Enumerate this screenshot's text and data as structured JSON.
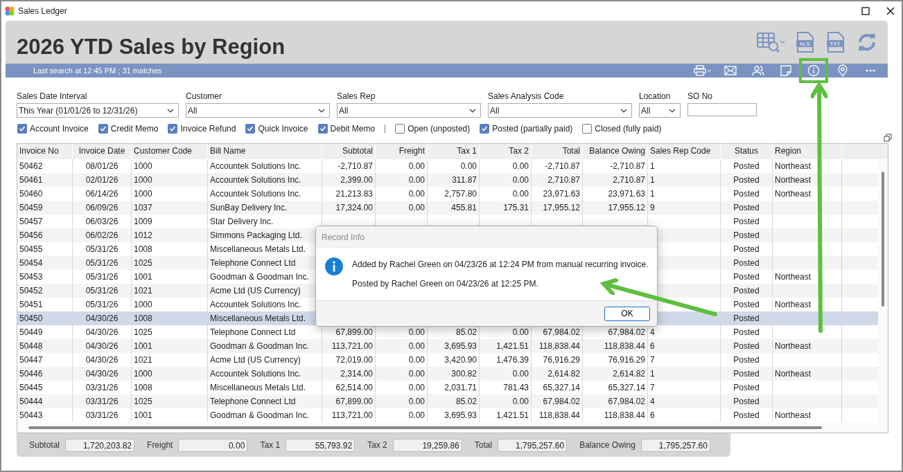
{
  "window": {
    "title": "Sales Ledger"
  },
  "report": {
    "title": "2026 YTD Sales by Region",
    "status": "Last search at 12:45 PM ; 31 matches"
  },
  "toolbar": [
    {
      "kind": "grid-search"
    },
    {
      "kind": "file",
      "label": "XLS"
    },
    {
      "kind": "file",
      "label": "TXT"
    },
    {
      "kind": "refresh"
    }
  ],
  "actions": [
    {
      "kind": "print",
      "highlighted": false
    },
    {
      "kind": "mail",
      "highlighted": false
    },
    {
      "kind": "people",
      "highlighted": false
    },
    {
      "kind": "note",
      "highlighted": false
    },
    {
      "kind": "info",
      "highlighted": true
    },
    {
      "kind": "pin",
      "highlighted": false
    },
    {
      "kind": "more",
      "highlighted": false
    }
  ],
  "filters": [
    {
      "label": "Sales Date Interval",
      "kind": "dropdown",
      "value": "This Year (01/01/26 to 12/31/26)"
    },
    {
      "label": "Customer",
      "kind": "dropdown",
      "value": "All"
    },
    {
      "label": "Sales Rep",
      "kind": "dropdown",
      "value": "All"
    },
    {
      "label": "Sales Analysis Code",
      "kind": "dropdown",
      "value": "All"
    },
    {
      "label": "Location",
      "kind": "dropdown",
      "value": "All"
    },
    {
      "label": "SO No",
      "kind": "text"
    }
  ],
  "document_types": [
    {
      "label": "Account Invoice",
      "checked": true
    },
    {
      "label": "Credit Memo",
      "checked": true
    },
    {
      "label": "Invoice Refund",
      "checked": true
    },
    {
      "label": "Quick Invoice",
      "checked": true
    },
    {
      "label": "Debit Memo",
      "checked": true
    }
  ],
  "posting_statuses": [
    {
      "label": "Open (unposted)",
      "checked": false
    },
    {
      "label": "Posted (partially paid)",
      "checked": true
    },
    {
      "label": "Closed (fully paid)",
      "checked": false
    }
  ],
  "table": {
    "columns": [
      "Invoice No",
      "Invoice Date",
      "Customer Code",
      "Bill Name",
      "Subtotal",
      "Freight",
      "Tax 1",
      "Tax 2",
      "Total",
      "Balance Owing",
      "Sales Rep Code",
      "Status",
      "Region"
    ],
    "rows": [
      {
        "selected": false,
        "cells": [
          "50462",
          "08/01/26",
          "1000",
          "Accountek Solutions Inc.",
          "-2,710.87",
          "0.00",
          "0.00",
          "0.00",
          "-2,710.87",
          "-2,710.87",
          "1",
          "Posted",
          "Northeast"
        ]
      },
      {
        "selected": false,
        "cells": [
          "50461",
          "02/01/26",
          "1000",
          "Accountek Solutions Inc.",
          "2,399.00",
          "0.00",
          "311.87",
          "0.00",
          "2,710.87",
          "2,710.87",
          "1",
          "Posted",
          "Northeast"
        ]
      },
      {
        "selected": false,
        "cells": [
          "50460",
          "06/14/26",
          "1000",
          "Accountek Solutions Inc.",
          "21,213.83",
          "0.00",
          "2,757.80",
          "0.00",
          "23,971.63",
          "23,971.63",
          "1",
          "Posted",
          "Northeast"
        ]
      },
      {
        "selected": false,
        "cells": [
          "50459",
          "06/09/26",
          "1037",
          "SunBay Delivery Inc.",
          "17,324.00",
          "0.00",
          "455.81",
          "175.31",
          "17,955.12",
          "17,955.12",
          "9",
          "Posted",
          null
        ]
      },
      {
        "selected": false,
        "cells": [
          "50457",
          "06/03/26",
          "1009",
          "Star Delivery Inc.",
          null,
          null,
          null,
          null,
          null,
          null,
          null,
          "Posted",
          null
        ]
      },
      {
        "selected": false,
        "cells": [
          "50456",
          "06/02/26",
          "1012",
          "Simmons Packaging Ltd.",
          null,
          null,
          null,
          null,
          null,
          null,
          null,
          "Posted",
          null
        ]
      },
      {
        "selected": false,
        "cells": [
          "50455",
          "05/31/26",
          "1008",
          "Miscellaneous Metals Ltd.",
          null,
          null,
          null,
          null,
          null,
          null,
          null,
          "Posted",
          null
        ]
      },
      {
        "selected": false,
        "cells": [
          "50454",
          "05/31/26",
          "1025",
          "Telephone Connect Ltd",
          null,
          null,
          null,
          null,
          null,
          null,
          null,
          "Posted",
          null
        ]
      },
      {
        "selected": false,
        "cells": [
          "50453",
          "05/31/26",
          "1001",
          "Goodman & Goodman Inc.",
          null,
          null,
          null,
          null,
          null,
          null,
          null,
          "Posted",
          "Northeast"
        ]
      },
      {
        "selected": false,
        "cells": [
          "50452",
          "05/31/26",
          "1021",
          "Acme Ltd (US Currency)",
          null,
          null,
          null,
          null,
          null,
          null,
          null,
          "Posted",
          null
        ]
      },
      {
        "selected": false,
        "cells": [
          "50451",
          "05/31/26",
          "1000",
          "Accountek Solutions Inc.",
          null,
          null,
          null,
          null,
          null,
          null,
          null,
          "Posted",
          "Northeast"
        ]
      },
      {
        "selected": true,
        "cells": [
          "50450",
          "04/30/26",
          "1008",
          "Miscellaneous Metals Ltd.",
          null,
          null,
          null,
          null,
          null,
          null,
          null,
          "Posted",
          null
        ]
      },
      {
        "selected": false,
        "cells": [
          "50449",
          "04/30/26",
          "1025",
          "Telephone Connect Ltd",
          "67,899.00",
          "0.00",
          "85.02",
          "0.00",
          "67,984.02",
          "67,984.02",
          "4",
          "Posted",
          null
        ]
      },
      {
        "selected": false,
        "cells": [
          "50448",
          "04/30/26",
          "1001",
          "Goodman & Goodman Inc.",
          "113,721.00",
          "0.00",
          "3,695.93",
          "1,421.51",
          "118,838.44",
          "118,838.44",
          "6",
          "Posted",
          "Northeast"
        ]
      },
      {
        "selected": false,
        "cells": [
          "50447",
          "04/30/26",
          "1021",
          "Acme Ltd (US Currency)",
          "72,019.00",
          "0.00",
          "3,420.90",
          "1,476.39",
          "76,916.29",
          "76,916.29",
          "7",
          "Posted",
          null
        ]
      },
      {
        "selected": false,
        "cells": [
          "50446",
          "04/30/26",
          "1000",
          "Accountek Solutions Inc.",
          "2,314.00",
          "0.00",
          "300.82",
          "0.00",
          "2,614.82",
          "2,614.82",
          "1",
          "Posted",
          "Northeast"
        ]
      },
      {
        "selected": false,
        "cells": [
          "50445",
          "03/31/26",
          "1008",
          "Miscellaneous Metals Ltd.",
          "62,514.00",
          "0.00",
          "2,031.71",
          "781.43",
          "65,327.14",
          "65,327.14",
          "7",
          "Posted",
          null
        ]
      },
      {
        "selected": false,
        "cells": [
          "50444",
          "03/31/26",
          "1025",
          "Telephone Connect Ltd",
          "67,899.00",
          "0.00",
          "85.02",
          "0.00",
          "67,984.02",
          "67,984.02",
          "4",
          "Posted",
          null
        ]
      },
      {
        "selected": false,
        "cells": [
          "50443",
          "03/31/26",
          "1001",
          "Goodman & Goodman Inc.",
          "113,721.00",
          "0.00",
          "3,695.93",
          "1,421.51",
          "118,838.44",
          "118,838.44",
          "6",
          "Posted",
          "Northeast"
        ]
      }
    ]
  },
  "totals": [
    {
      "label": "Subtotal",
      "value": "1,720,203.82"
    },
    {
      "label": "Freight",
      "value": "0.00"
    },
    {
      "label": "Tax 1",
      "value": "55,793.92"
    },
    {
      "label": "Tax 2",
      "value": "19,259.86"
    },
    {
      "label": "Total",
      "value": "1,795,257.60"
    },
    {
      "label": "Balance Owing",
      "value": "1,795,257.60"
    }
  ],
  "dialog": {
    "title": "Record Info",
    "lines": [
      "Added by Rachel Green on 04/23/26 at 12:24 PM from manual recurring invoice.",
      "Posted by Rachel Green on 04/23/26 at 12:25 PM."
    ],
    "button": "OK"
  }
}
